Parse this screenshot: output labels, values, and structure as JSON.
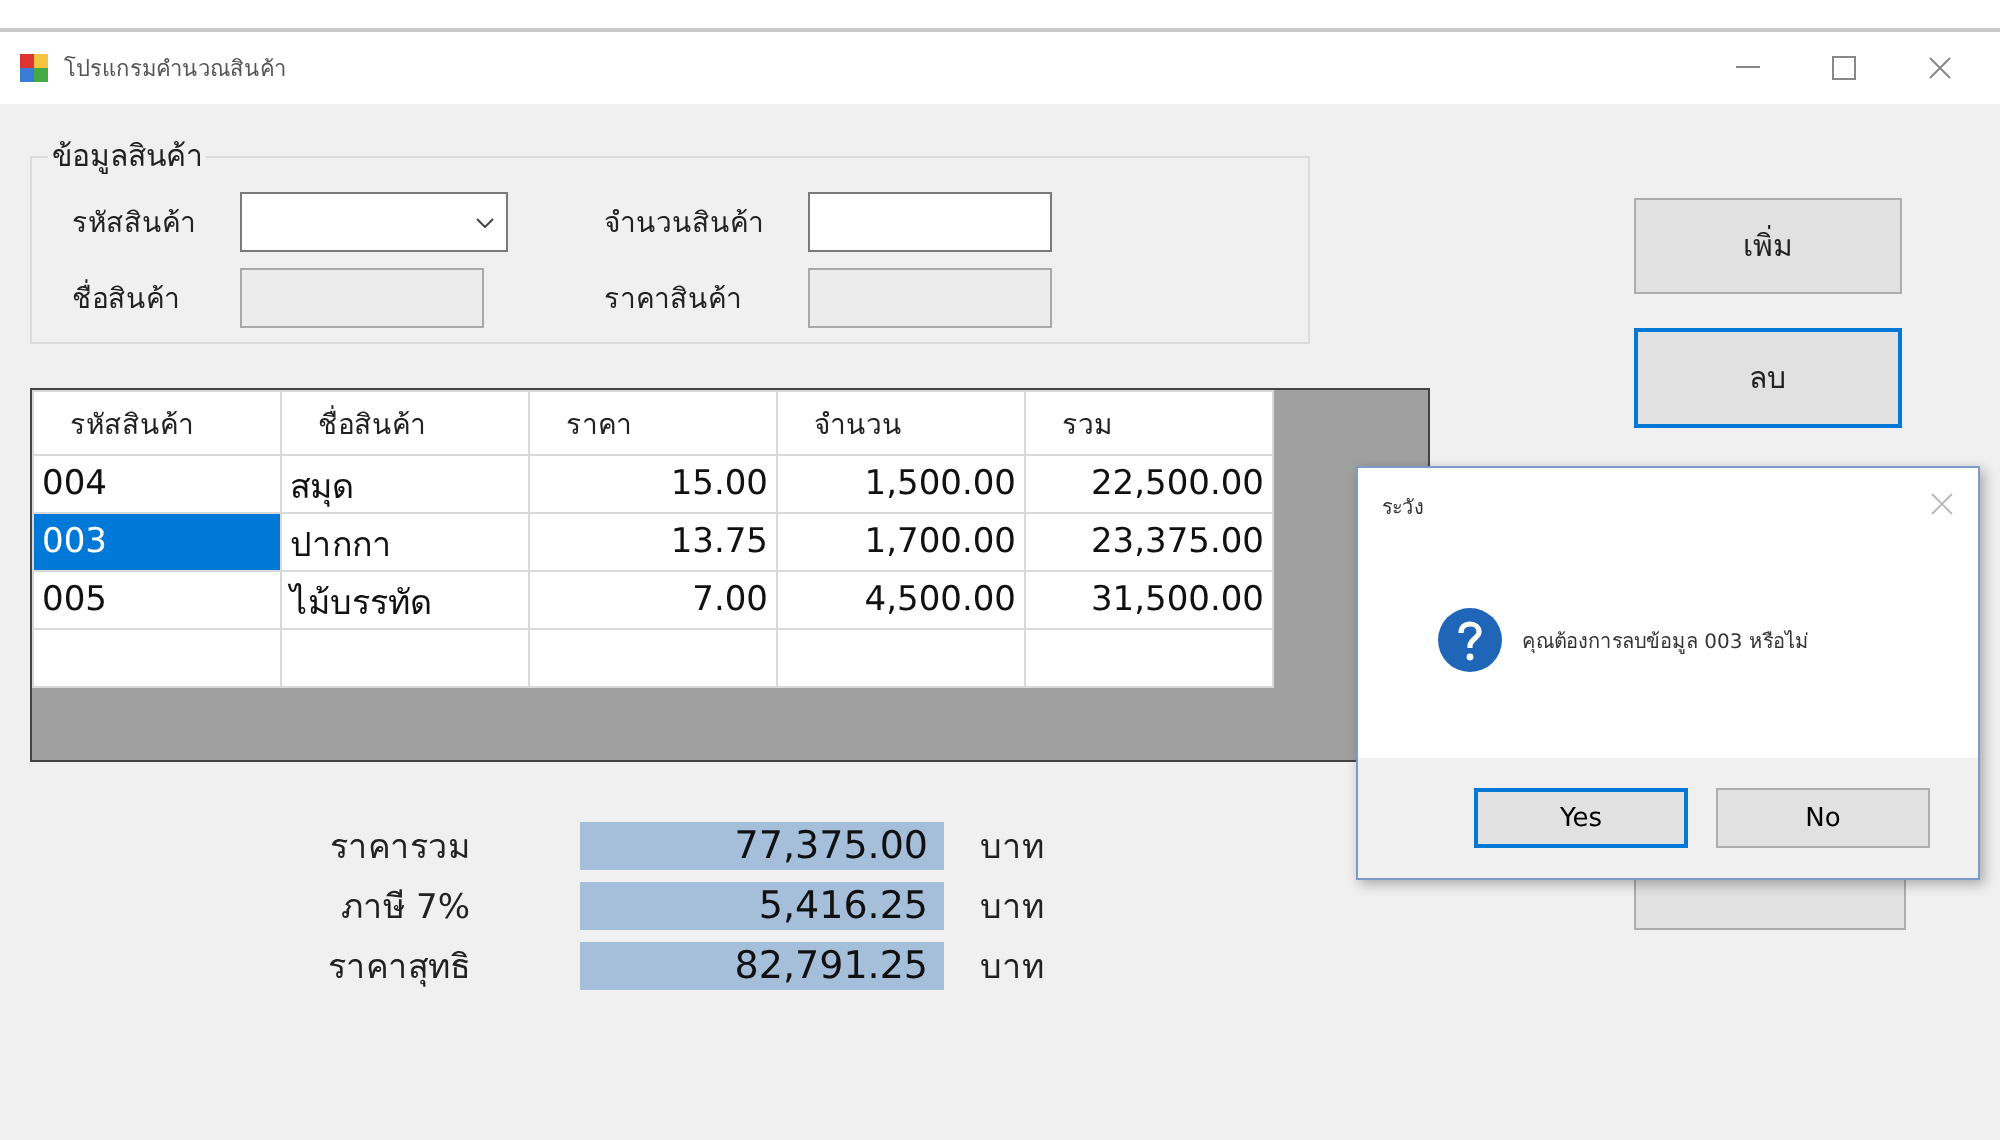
{
  "window": {
    "title": "โปรแกรมคำนวณสินค้า"
  },
  "product_group": {
    "title": "ข้อมูลสินค้า",
    "fields": [
      {
        "label": "รหัสสินค้า",
        "kind": "combo",
        "disabled": false
      },
      {
        "label": "จำนวนสินค้า",
        "kind": "text",
        "disabled": false
      },
      {
        "label": "ชื่อสินค้า",
        "kind": "text",
        "disabled": true
      },
      {
        "label": "ราคาสินค้า",
        "kind": "text",
        "disabled": true
      }
    ]
  },
  "grid": {
    "columns": [
      "รหัสสินค้า",
      "ชื่อสินค้า",
      "ราคา",
      "จำนวน",
      "รวม"
    ],
    "rows": [
      {
        "cells": [
          "004",
          "สมุด",
          "15.00",
          "1,500.00",
          "22,500.00"
        ],
        "selected": false
      },
      {
        "cells": [
          "003",
          "ปากกา",
          "13.75",
          "1,700.00",
          "23,375.00"
        ],
        "selected": true
      },
      {
        "cells": [
          "005",
          "ไม้บรรทัด",
          "7.00",
          "4,500.00",
          "31,500.00"
        ],
        "selected": false
      }
    ]
  },
  "totals": [
    {
      "label": "ราคารวม",
      "value": "77,375.00",
      "unit": "บาท"
    },
    {
      "label": "ภาษี 7%",
      "value": "5,416.25",
      "unit": "บาท"
    },
    {
      "label": "ราคาสุทธิ",
      "value": "82,791.25",
      "unit": "บาท"
    }
  ],
  "buttons": [
    {
      "label": "เพิ่ม",
      "focused": false
    },
    {
      "label": "ลบ",
      "focused": true
    }
  ],
  "dialog": {
    "title": "ระวัง",
    "message": "คุณต้องการลบข้อมูล 003 หรือไม่",
    "buttons": [
      {
        "label": "Yes",
        "focused": true
      },
      {
        "label": "No",
        "focused": false
      }
    ]
  }
}
